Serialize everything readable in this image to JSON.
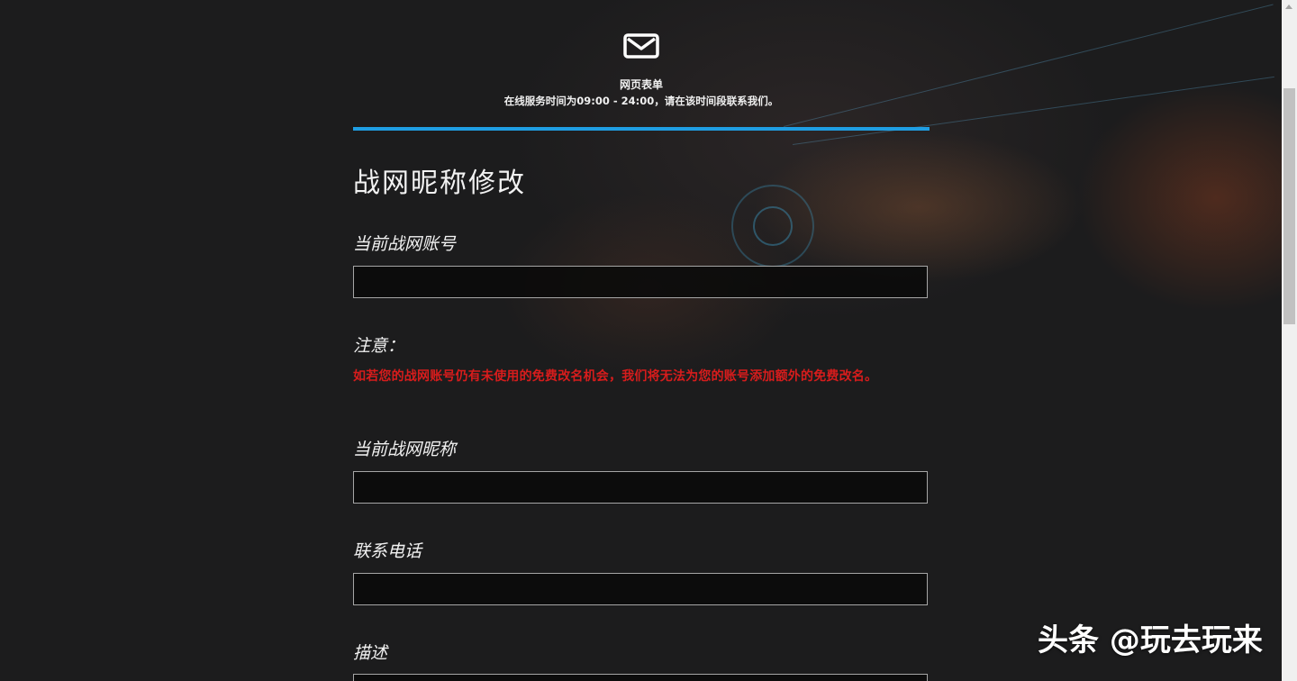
{
  "header": {
    "form_title": "网页表单",
    "service_hours": "在线服务时间为09:00 - 24:00，请在该时间段联系我们。"
  },
  "page_heading": "战网昵称修改",
  "fields": {
    "account_label": "当前战网账号",
    "account_value": "",
    "nickname_label": "当前战网昵称",
    "nickname_value": "",
    "phone_label": "联系电话",
    "phone_value": "",
    "description_label": "描述",
    "description_value": ""
  },
  "notice": {
    "label": "注意：",
    "text": "如若您的战网账号仍有未使用的免费改名机会，我们将无法为您的账号添加额外的免费改名。"
  },
  "watermark": "头条 @玩去玩来",
  "colors": {
    "accent": "#1f9ee3",
    "notice": "#d71c1c",
    "background": "#1c1c1d"
  },
  "icons": {
    "header_icon": "mail-icon"
  }
}
